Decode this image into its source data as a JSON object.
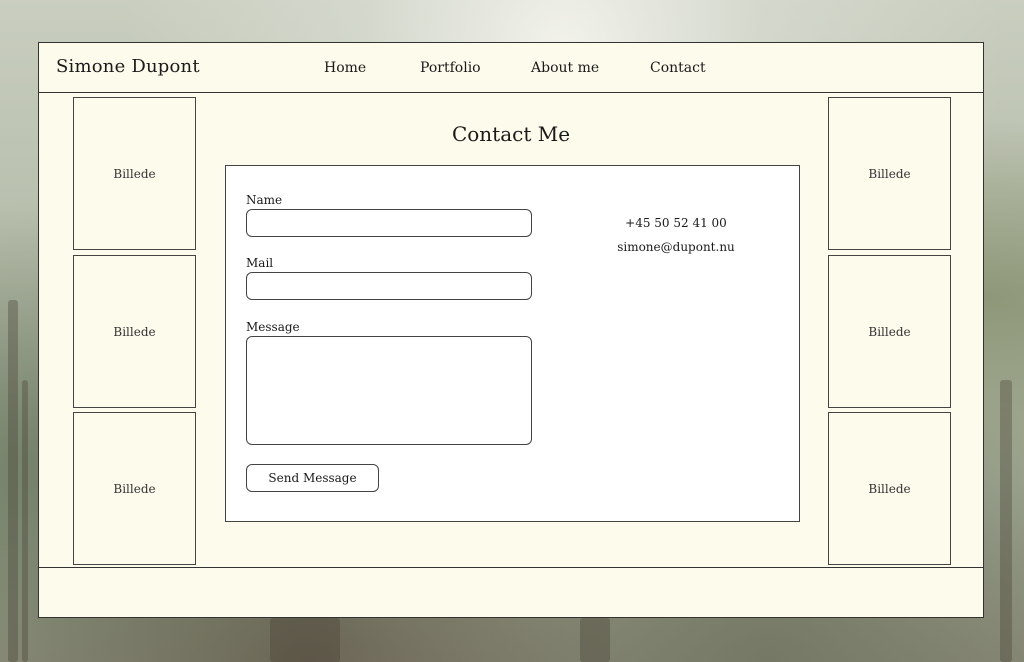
{
  "header": {
    "brand": "Simone Dupont",
    "nav": [
      "Home",
      "Portfolio",
      "About me",
      "Contact"
    ]
  },
  "gallery": {
    "left": [
      "Billede",
      "Billede",
      "Billede"
    ],
    "right": [
      "Billede",
      "Billede",
      "Billede"
    ]
  },
  "main": {
    "title": "Contact Me",
    "form": {
      "name_label": "Name",
      "name_value": "",
      "mail_label": "Mail",
      "mail_value": "",
      "message_label": "Message",
      "message_value": "",
      "send_label": "Send Message"
    },
    "contact": {
      "phone": "+45 50 52 41 00",
      "email": "simone@dupont.nu"
    }
  },
  "colors": {
    "panel": "#fdfbec",
    "card": "#ffffff",
    "border": "#333333"
  }
}
